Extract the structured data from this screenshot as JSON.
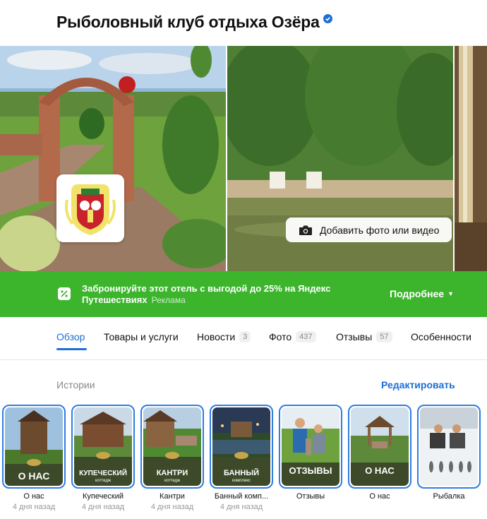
{
  "header": {
    "title": "Рыболовный клуб отдыха Озёра"
  },
  "gallery": {
    "add_photo_label": "Добавить фото или видео"
  },
  "promo": {
    "text": "Забронируйте этот отель с выгодой до 25% на Яндекс Путешествиях",
    "ad_label": "Реклама",
    "more_label": "Подробнее"
  },
  "tabs": [
    {
      "label": "Обзор",
      "count": null
    },
    {
      "label": "Товары и услуги",
      "count": null
    },
    {
      "label": "Новости",
      "count": "3"
    },
    {
      "label": "Фото",
      "count": "437"
    },
    {
      "label": "Отзывы",
      "count": "57"
    },
    {
      "label": "Особенности",
      "count": null
    }
  ],
  "stories": {
    "label": "Истории",
    "edit_label": "Редактировать",
    "items": [
      {
        "title": "О нас",
        "time": "4 дня назад",
        "caption": "О НАС"
      },
      {
        "title": "Купеческий",
        "time": "4 дня назад",
        "caption": "КУПЕЧЕСКИЙ",
        "subcaption": "коттедж"
      },
      {
        "title": "Кантри",
        "time": "4 дня назад",
        "caption": "КАНТРИ",
        "subcaption": "коттедж"
      },
      {
        "title": "Банный комп...",
        "time": "4 дня назад",
        "caption": "БАННЫЙ",
        "subcaption": "комплекс"
      },
      {
        "title": "Отзывы",
        "time": "",
        "caption": "ОТЗЫВЫ"
      },
      {
        "title": "О нас",
        "time": "",
        "caption": "О НАС"
      },
      {
        "title": "Рыбалка",
        "time": "",
        "caption": ""
      }
    ]
  },
  "colors": {
    "accent": "#1b6fd6",
    "promo_green": "#3cb52d",
    "story_border": "#2f7de1",
    "story_green": "#3c4a2a"
  }
}
